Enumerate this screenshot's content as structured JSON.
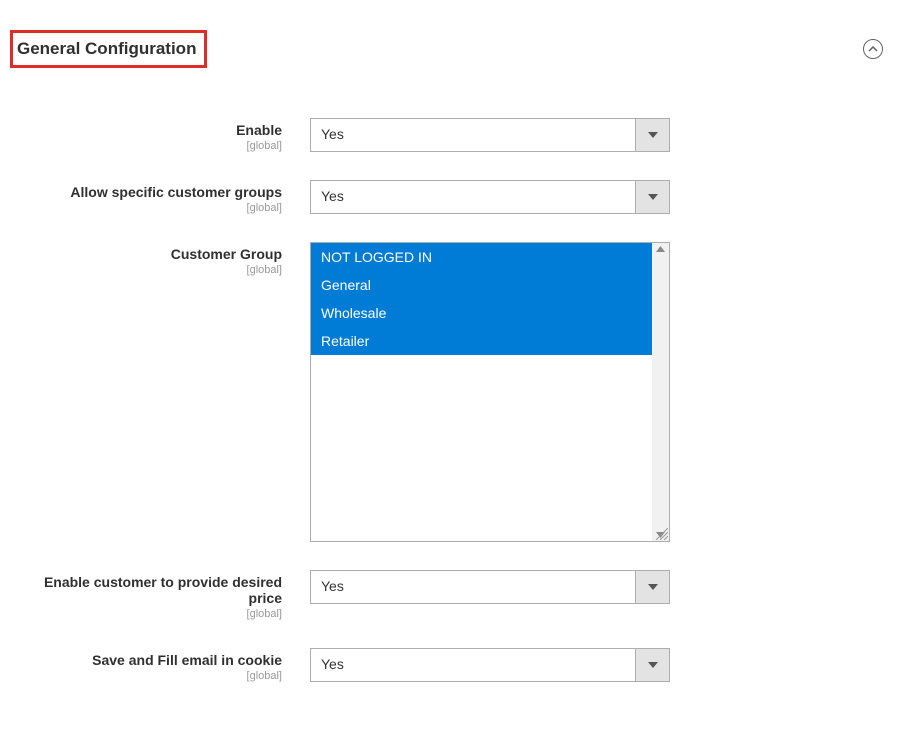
{
  "section": {
    "title": "General Configuration"
  },
  "scope_label": "[global]",
  "fields": {
    "enable": {
      "label": "Enable",
      "value": "Yes"
    },
    "allow_groups": {
      "label": "Allow specific customer groups",
      "value": "Yes"
    },
    "customer_group": {
      "label": "Customer Group",
      "options": [
        "NOT LOGGED IN",
        "General",
        "Wholesale",
        "Retailer"
      ]
    },
    "desired_price": {
      "label": "Enable customer to provide desired price",
      "value": "Yes"
    },
    "save_email": {
      "label": "Save and Fill email in cookie",
      "value": "Yes"
    }
  }
}
